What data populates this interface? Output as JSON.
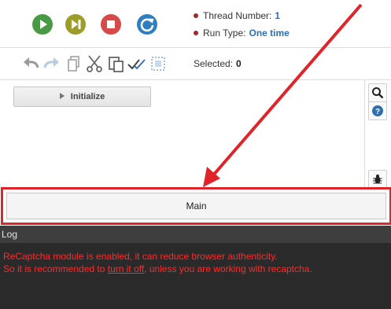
{
  "run_controls": {
    "thread_number_label": "Thread Number:",
    "thread_number_value": "1",
    "run_type_label": "Run Type:",
    "run_type_value": "One time",
    "colors": {
      "play": "#4a9a45",
      "step": "#9c9c2b",
      "stop": "#d84a4a",
      "restart": "#2f7fc0"
    }
  },
  "toolbar": {
    "selected_label": "Selected:",
    "selected_count": "0",
    "icons": [
      "undo-icon",
      "redo-icon",
      "copy-icon",
      "cut-icon",
      "paste-icon",
      "check-all-icon",
      "select-area-icon"
    ]
  },
  "workarea": {
    "initialize_label": "Initialize"
  },
  "side_panel": {
    "icons": [
      "search-icon",
      "help-icon",
      "bug-icon"
    ]
  },
  "tabs": {
    "main_label": "Main"
  },
  "log": {
    "title": "Log",
    "line1": "ReCaptcha module is enabled, it can reduce browser authenticity.",
    "line2_prefix": "So it is recommended to ",
    "line2_link": "turn it off",
    "line2_suffix": ", unless you are working with recaptcha."
  },
  "annotation": {
    "color": "#e0242a"
  }
}
